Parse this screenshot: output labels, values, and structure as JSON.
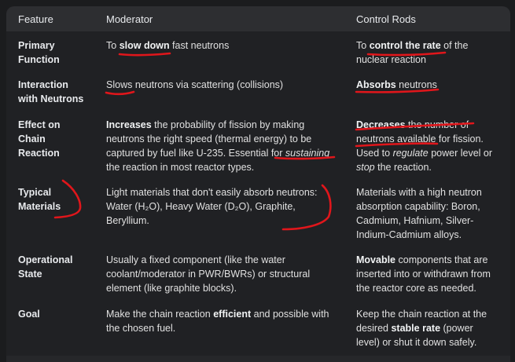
{
  "table": {
    "headers": [
      "Feature",
      "Moderator",
      "Control Rods"
    ],
    "rows": {
      "primary": {
        "label_a": "Primary",
        "label_b": "Function",
        "mod": [
          "To ",
          "slow down",
          " fast neutrons"
        ],
        "rod_a": [
          "To ",
          "control the rate",
          " of the"
        ],
        "rod_b": "nuclear reaction"
      },
      "interaction": {
        "label_a": "Interaction",
        "label_b": "with Neutrons",
        "mod": "Slows neutrons via scattering (collisions)",
        "rod": [
          "Absorbs",
          " neutrons"
        ]
      },
      "effect": {
        "label_a": "Effect on",
        "label_b": "Chain",
        "label_c": "Reaction",
        "mod_l1": [
          "Increases",
          " the probability of fission by making"
        ],
        "mod_l2": "neutrons the right speed (thermal energy) to be",
        "mod_l3": [
          "captured by fuel like U-235. Essential for ",
          "sustaining"
        ],
        "mod_l4": "the reaction in most reactor types.",
        "rod_l1": [
          "Decreases",
          " the number of"
        ],
        "rod_l2": "neutrons available for fission.",
        "rod_l3": [
          "Used to ",
          "regulate",
          " power level or"
        ],
        "rod_l4": [
          "stop",
          " the reaction."
        ]
      },
      "materials": {
        "label_a": "Typical",
        "label_b": "Materials",
        "mod_l1": "Light materials that don't easily absorb neutrons:",
        "mod_l2": "Water (H₂O), Heavy Water (D₂O), Graphite,",
        "mod_l3": "Beryllium.",
        "rod_l1": "Materials with a high neutron",
        "rod_l2": "absorption capability: Boron,",
        "rod_l3": "Cadmium, Hafnium, Silver-",
        "rod_l4": "Indium-Cadmium alloys."
      },
      "state": {
        "label_a": "Operational",
        "label_b": "State",
        "mod_l1": "Usually a fixed component (like the water",
        "mod_l2": "coolant/moderator in PWR/BWRs) or structural",
        "mod_l3": "element (like graphite blocks).",
        "rod_l1": [
          "Movable",
          " components that are"
        ],
        "rod_l2": "inserted into or withdrawn from",
        "rod_l3": "the reactor core as needed."
      },
      "goal": {
        "label_a": "Goal",
        "mod_l1": [
          "Make the chain reaction ",
          "efficient",
          " and possible with"
        ],
        "mod_l2": "the chosen fuel.",
        "rod_l1": "Keep the chain reaction at the",
        "rod_l2": [
          "desired ",
          "stable rate",
          " (power"
        ],
        "rod_l3": "level) or shut it down safely."
      }
    }
  },
  "colors": {
    "annotation": "#e0161b",
    "background": "#202124",
    "header": "#2d2e31"
  }
}
